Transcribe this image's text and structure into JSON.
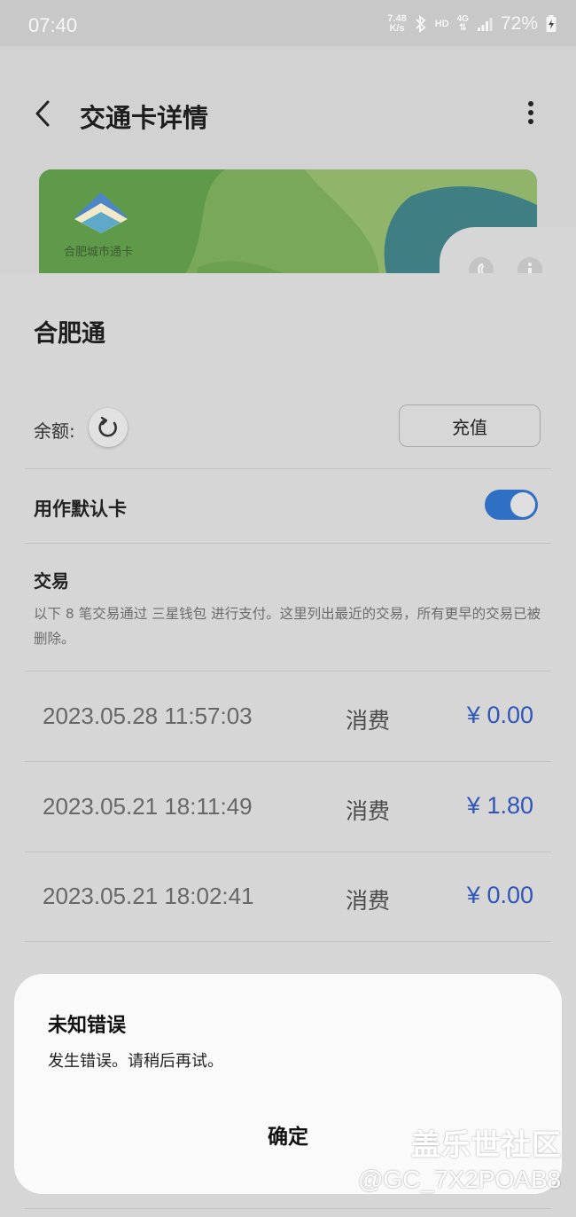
{
  "status_bar": {
    "time": "07:40",
    "net_speed_value": "7.48",
    "net_speed_unit": "K/s",
    "hd_label": "HD",
    "network_label": "4G",
    "battery": "72%"
  },
  "header": {
    "title": "交通卡详情"
  },
  "card": {
    "issuer_label": "合肥城市通卡",
    "name": "合肥通"
  },
  "balance": {
    "label": "余额:",
    "topup_button": "充值"
  },
  "default_card": {
    "label": "用作默认卡",
    "enabled": true
  },
  "transactions": {
    "title": "交易",
    "description": "以下 8 笔交易通过 三星钱包 进行支付。这里列出最近的交易，所有更早的交易已被删除。",
    "rows": [
      {
        "date": "2023.05.28  11:57:03",
        "type": "消费",
        "amount": "¥ 0.00"
      },
      {
        "date": "2023.05.21  18:11:49",
        "type": "消费",
        "amount": "¥ 1.80"
      },
      {
        "date": "2023.05.21  18:02:41",
        "type": "消费",
        "amount": "¥ 0.00"
      }
    ]
  },
  "dialog": {
    "title": "未知错误",
    "message": "发生错误。请稍后再试。",
    "ok_button": "确定"
  },
  "watermark": {
    "site": "盖乐世社区",
    "user": "@GC_7X2POAB8"
  },
  "colors": {
    "accent": "#2f6fc4",
    "amount": "#2f55b8"
  }
}
